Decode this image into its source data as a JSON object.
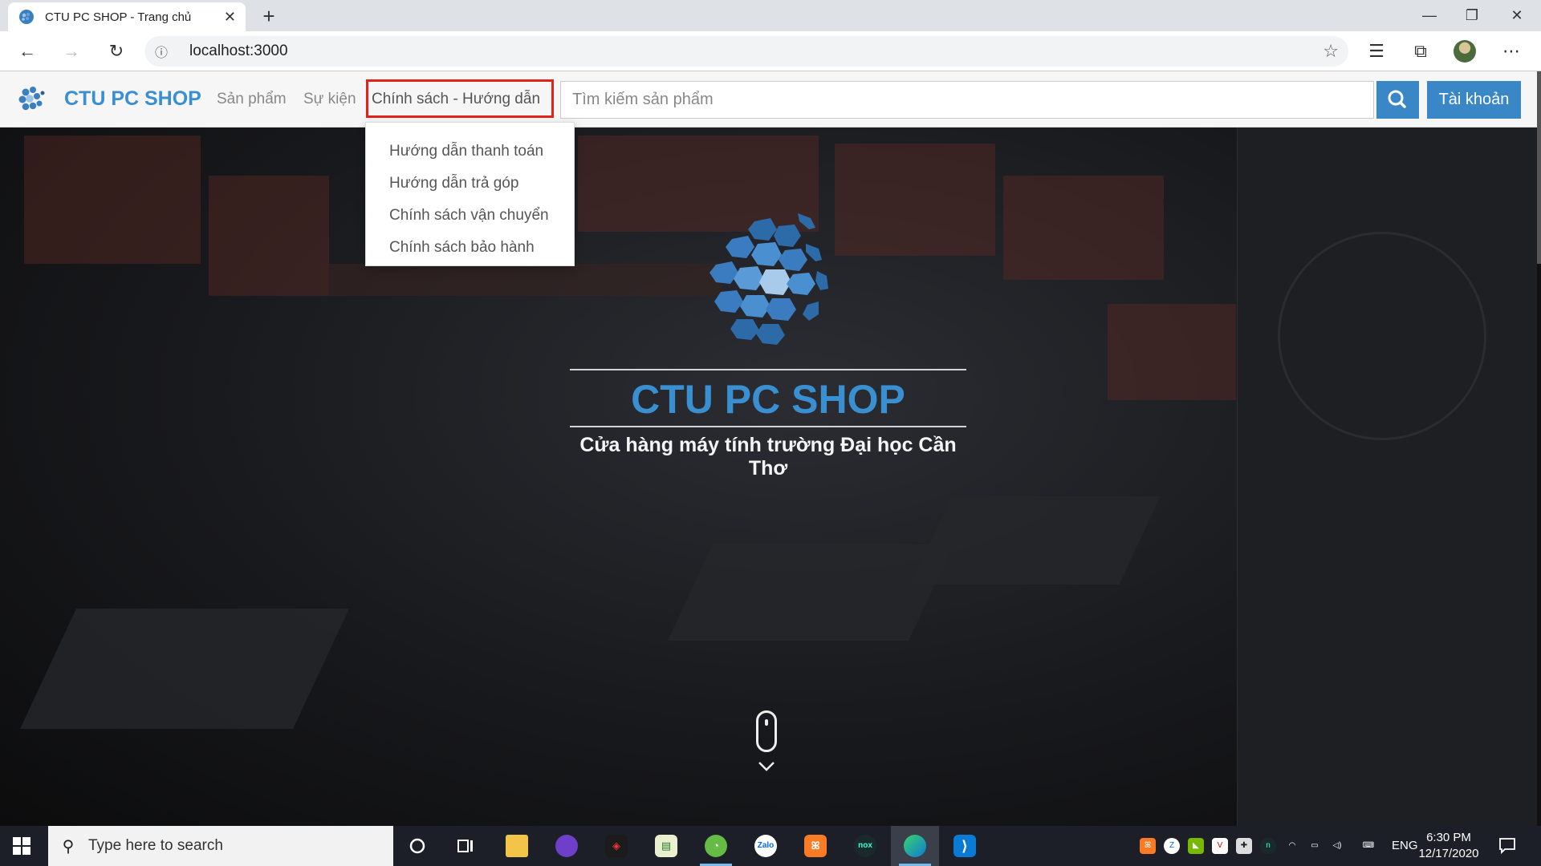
{
  "browser": {
    "tab_title": "CTU PC SHOP - Trang chủ",
    "address": "localhost:3000"
  },
  "site": {
    "brand": "CTU PC SHOP",
    "nav": [
      "Sản phẩm",
      "Sự kiện",
      "Chính sách - Hướng dẫn"
    ],
    "search_placeholder": "Tìm kiếm sản phẩm",
    "account_label": "Tài khoản"
  },
  "dropdown": {
    "items": [
      "Hướng dẫn thanh toán",
      "Hướng dẫn trả góp",
      "Chính sách vận chuyển",
      "Chính sách bảo hành"
    ]
  },
  "hero": {
    "title": "CTU PC SHOP",
    "subtitle": "Cửa hàng máy tính trường Đại học Cần Thơ"
  },
  "taskbar": {
    "search_placeholder": "Type here to search",
    "language": "ENG",
    "time": "6:30 PM",
    "date": "12/17/2020"
  },
  "colors": {
    "brand": "#3a8fd0",
    "button": "#3a87c7",
    "highlight": "#e2231a"
  }
}
